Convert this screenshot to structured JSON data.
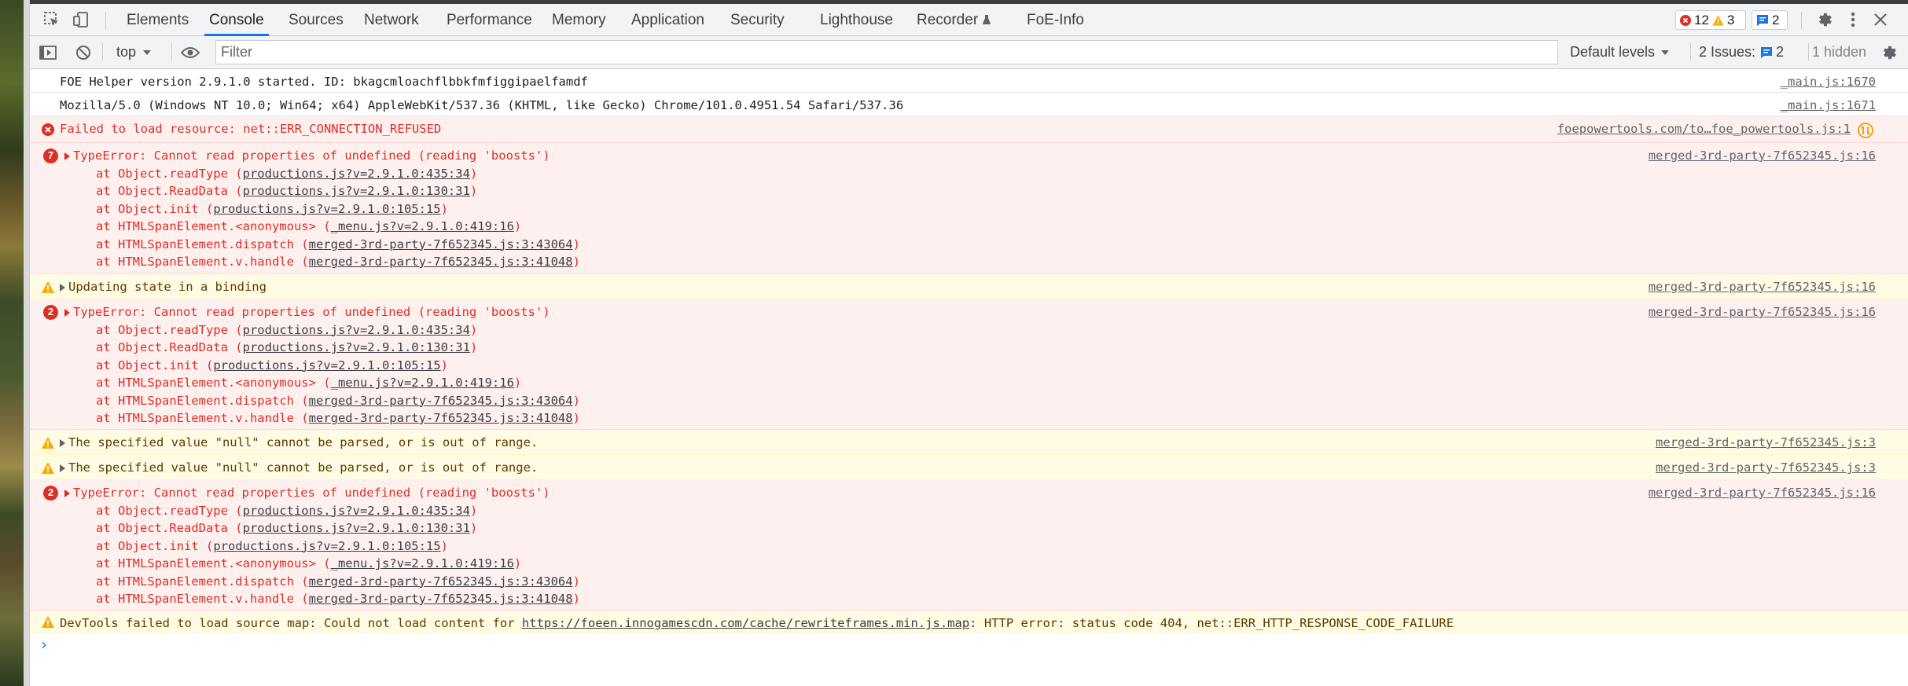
{
  "tabs": [
    {
      "label": "Elements"
    },
    {
      "label": "Console"
    },
    {
      "label": "Sources"
    },
    {
      "label": "Network"
    },
    {
      "label": "Performance"
    },
    {
      "label": "Memory"
    },
    {
      "label": "Application"
    },
    {
      "label": "Security"
    },
    {
      "label": "Lighthouse"
    },
    {
      "label": "Recorder"
    },
    {
      "label": "FoE-Info"
    }
  ],
  "counters": {
    "errors": "12",
    "warnings": "3",
    "issues": "2"
  },
  "toolbar": {
    "context": "top",
    "filter_placeholder": "Filter",
    "levels": "Default levels",
    "issues_label": "2 Issues:",
    "issues_count": "2",
    "hidden": "1 hidden"
  },
  "messages": {
    "m1": {
      "text": "FOE Helper version 2.9.1.0 started. ID: bkagcmloachflbbkfmfiggipaelfamdf",
      "src": "_main.js:1670"
    },
    "m2": {
      "text": "Mozilla/5.0 (Windows NT 10.0; Win64; x64) AppleWebKit/537.36 (KHTML, like Gecko) Chrome/101.0.4951.54 Safari/537.36",
      "src": "_main.js:1671"
    },
    "m3": {
      "text": "Failed to load resource: net::ERR_CONNECTION_REFUSED",
      "src": "foepowertools.com/to…foe_powertools.js:1"
    },
    "m4": {
      "count": "7",
      "text": "TypeError: Cannot read properties of undefined (reading 'boosts')",
      "src": "merged-3rd-party-7f652345.js:16"
    },
    "m5": {
      "text": "Updating state in a binding",
      "src": "merged-3rd-party-7f652345.js:16"
    },
    "m6": {
      "count": "2",
      "text": "TypeError: Cannot read properties of undefined (reading 'boosts')",
      "src": "merged-3rd-party-7f652345.js:16"
    },
    "m7": {
      "text": "The specified value \"null\" cannot be parsed, or is out of range.",
      "src": "merged-3rd-party-7f652345.js:3"
    },
    "m8": {
      "text": "The specified value \"null\" cannot be parsed, or is out of range.",
      "src": "merged-3rd-party-7f652345.js:3"
    },
    "m9": {
      "count": "2",
      "text": "TypeError: Cannot read properties of undefined (reading 'boosts')",
      "src": "merged-3rd-party-7f652345.js:16"
    },
    "m10": {
      "prefix": "DevTools failed to load source map: Could not load content for ",
      "link": "https://foeen.innogamescdn.com/cache/rewriteframes.min.js.map",
      "suffix": ": HTTP error: status code 404, net::ERR_HTTP_RESPONSE_CODE_FAILURE"
    }
  },
  "stack": [
    {
      "fn": "at Object.readType (",
      "loc": "productions.js?v=2.9.1.0:435:34"
    },
    {
      "fn": "at Object.ReadData (",
      "loc": "productions.js?v=2.9.1.0:130:31"
    },
    {
      "fn": "at Object.init (",
      "loc": "productions.js?v=2.9.1.0:105:15"
    },
    {
      "fn": "at HTMLSpanElement.<anonymous> (",
      "loc": "_menu.js?v=2.9.1.0:419:16"
    },
    {
      "fn": "at HTMLSpanElement.dispatch (",
      "loc": "merged-3rd-party-7f652345.js:3:43064"
    },
    {
      "fn": "at HTMLSpanElement.v.handle (",
      "loc": "merged-3rd-party-7f652345.js:3:41048"
    }
  ],
  "colors": {
    "accent": "#1a73e8",
    "error": "#d93025",
    "warning": "#f9ab00"
  }
}
